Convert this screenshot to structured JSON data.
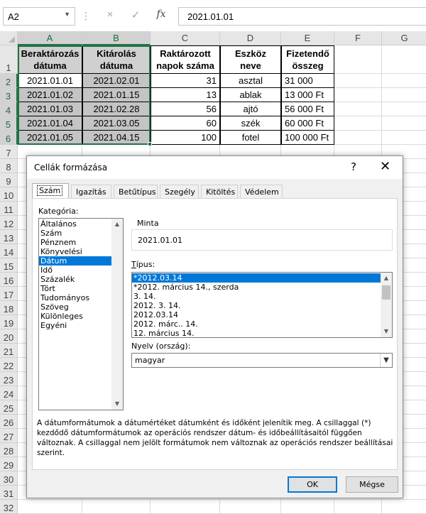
{
  "formula_bar": {
    "name_box": "A2",
    "cancel_icon": "×",
    "enter_icon": "✓",
    "fx_icon": "fx",
    "value": "2021.01.01"
  },
  "columns": [
    "A",
    "B",
    "C",
    "D",
    "E",
    "F",
    "G"
  ],
  "rows": [
    "1",
    "2",
    "3",
    "4",
    "5",
    "6",
    "7",
    "8",
    "9",
    "10",
    "11",
    "12",
    "13",
    "14",
    "15",
    "16",
    "17",
    "18",
    "19",
    "20",
    "21",
    "22",
    "23",
    "24",
    "25",
    "26",
    "27",
    "28",
    "29",
    "30",
    "31",
    "32"
  ],
  "table": {
    "headers": [
      "Beraktározás dátuma",
      "Kitárolás dátuma",
      "Raktározott napok száma",
      "Eszköz neve",
      "Fizetendő összeg"
    ],
    "rows": [
      [
        "2021.01.01",
        "2021.02.01",
        "31",
        "asztal",
        "31 000"
      ],
      [
        "2021.01.02",
        "2021.01.15",
        "13",
        "ablak",
        "13 000 Ft"
      ],
      [
        "2021.01.03",
        "2021.02.28",
        "56",
        "ajtó",
        "56 000 Ft"
      ],
      [
        "2021.01.04",
        "2021.03.05",
        "60",
        "szék",
        "60 000 Ft"
      ],
      [
        "2021.01.05",
        "2021.04.15",
        "100",
        "fotel",
        "100 000 Ft"
      ]
    ]
  },
  "dialog": {
    "title": "Cellák formázása",
    "help_icon": "?",
    "close_icon": "✕",
    "tabs": [
      "Szám",
      "Igazítás",
      "Betűtípus",
      "Szegély",
      "Kitöltés",
      "Védelem"
    ],
    "active_tab": "Szám",
    "category_label": "Kategória:",
    "categories": [
      "Általános",
      "Szám",
      "Pénznem",
      "Könyvelési",
      "Dátum",
      "Idő",
      "Százalék",
      "Tört",
      "Tudományos",
      "Szöveg",
      "Különleges",
      "Egyéni"
    ],
    "selected_category": "Dátum",
    "sample_label": "Minta",
    "sample_value": "2021.01.01",
    "type_label": "Típus:",
    "types": [
      "*2012.03.14",
      "*2012. március 14., szerda",
      "3. 14.",
      "2012. 3. 14.",
      "2012.03.14",
      "2012. márc.. 14.",
      "12. március 14."
    ],
    "selected_type": "*2012.03.14",
    "locale_label": "Nyelv (ország):",
    "locale_value": "magyar",
    "description": "A dátumformátumok a dátumértéket dátumként és időként jelenítik meg. A csillaggal (*) kezdődő dátumformátumok az operációs rendszer dátum- és időbeállításaitól függően változnak. A csillaggal nem jelölt formátumok nem változnak az operációs rendszer beállításai szerint.",
    "ok_label": "OK",
    "cancel_label": "Mégse"
  }
}
